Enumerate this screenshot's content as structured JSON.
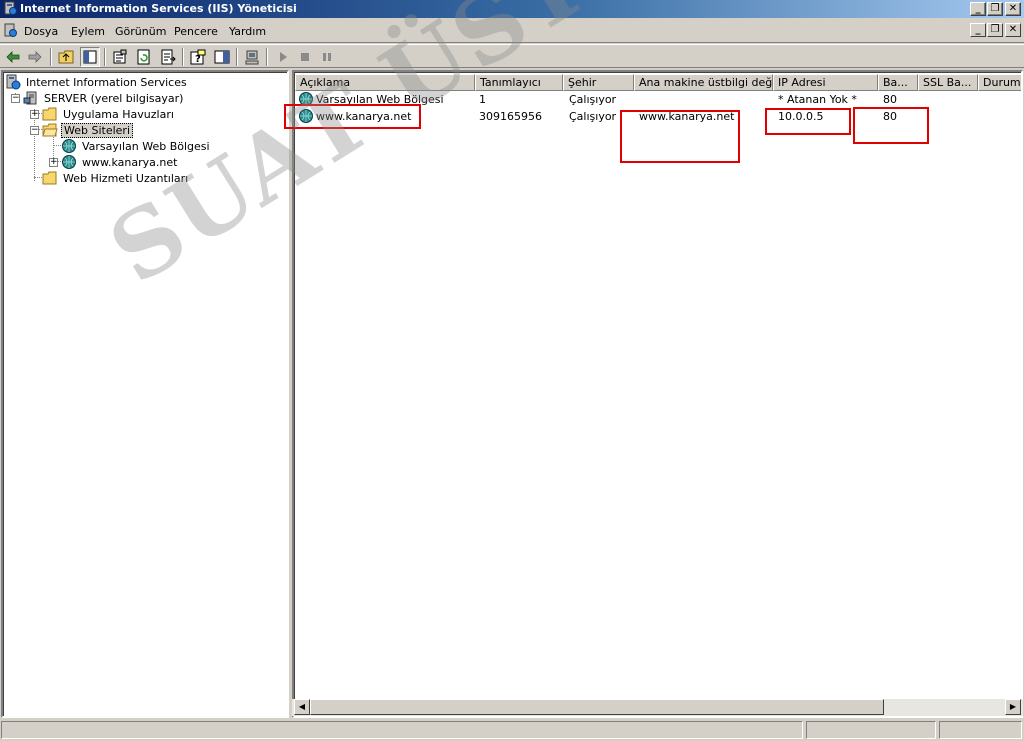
{
  "window": {
    "title": "Internet Information Services (IIS) Yöneticisi",
    "controls": {
      "minimize": "_",
      "restore": "❐",
      "close": "✕"
    }
  },
  "menu": {
    "items": [
      {
        "label": "Dosya"
      },
      {
        "label": "Eylem"
      },
      {
        "label": "Görünüm"
      },
      {
        "label": "Pencere"
      },
      {
        "label": "Yardım"
      }
    ]
  },
  "toolbar": {
    "buttons": [
      "back-arrow-icon",
      "forward-arrow-icon",
      "up-one-level-icon",
      "show-hide-tree-icon",
      "properties-icon",
      "refresh-icon",
      "export-list-icon",
      "help-icon",
      "action-pane-icon",
      "new-computer-icon",
      "start-icon",
      "stop-icon",
      "pause-icon"
    ]
  },
  "tree": {
    "root": "Internet Information Services",
    "server": "SERVER (yerel bilgisayar)",
    "app_pools": "Uygulama Havuzları",
    "web_sites": "Web Siteleri",
    "default_site": "Varsayılan Web Bölgesi",
    "kanarya_site": "www.kanarya.net",
    "extensions": "Web Hizmeti Uzantıları"
  },
  "list": {
    "columns": [
      "Açıklama",
      "Tanımlayıcı",
      "Şehir",
      "Ana makine üstbilgi değeri",
      "IP Adresi",
      "Ba...",
      "SSL Ba...",
      "Durum"
    ],
    "rows": [
      {
        "description": "Varsayılan Web Bölgesi",
        "identifier": "1",
        "state": "Çalışıyor",
        "host_header": "",
        "ip": "* Atanan Yok *",
        "port": "80",
        "ssl": "",
        "status": ""
      },
      {
        "description": "www.kanarya.net",
        "identifier": "309165956",
        "state": "Çalışıyor",
        "host_header": "www.kanarya.net",
        "ip": "10.0.0.5",
        "port": "80",
        "ssl": "",
        "status": ""
      }
    ]
  },
  "watermark": "SUAT ÜSTKAN",
  "colors": {
    "highlight": "#e00000",
    "title_start": "#0a246a",
    "title_end": "#a6caf0"
  }
}
